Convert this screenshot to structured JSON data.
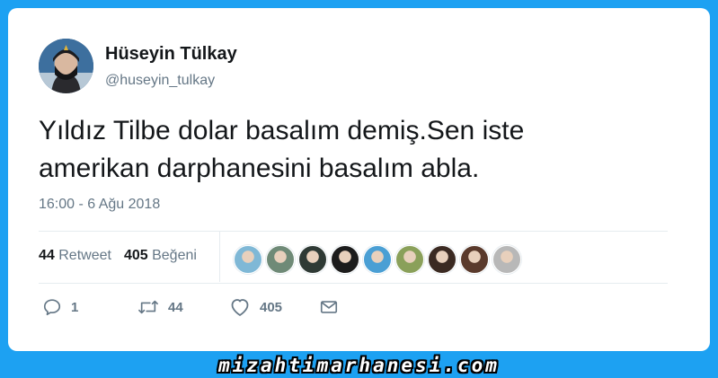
{
  "tweet": {
    "author_name": "Hüseyin Tülkay",
    "author_handle": "@huseyin_tulkay",
    "text": "Yıldız Tilbe dolar basalım demiş.Sen iste\namerikan darphanesini basalım abla.",
    "timestamp": "16:00 - 6 Ağu 2018",
    "retweet_count": "44",
    "retweet_label": "Retweet",
    "like_count": "405",
    "like_label": "Beğeni",
    "liker_avatars": [
      {
        "color": "#7fb8d6"
      },
      {
        "color": "#6f8a77"
      },
      {
        "color": "#2f3a35"
      },
      {
        "color": "#1c1c1c"
      },
      {
        "color": "#4a9fd4"
      },
      {
        "color": "#8aa05a"
      },
      {
        "color": "#3b2a22"
      },
      {
        "color": "#5a3a2c"
      },
      {
        "color": "#b8b8b8"
      }
    ]
  },
  "actions": {
    "reply_icon": "reply-icon",
    "reply_count": "1",
    "retweet_icon": "retweet-icon",
    "retweet_count": "44",
    "like_icon": "heart-icon",
    "like_count": "405",
    "dm_icon": "envelope-icon"
  },
  "watermark": "mizahtimarhanesi.com",
  "colors": {
    "background": "#1da1f2",
    "card": "#ffffff",
    "primary_text": "#14171a",
    "secondary_text": "#657786",
    "divider": "#e6ecf0"
  }
}
